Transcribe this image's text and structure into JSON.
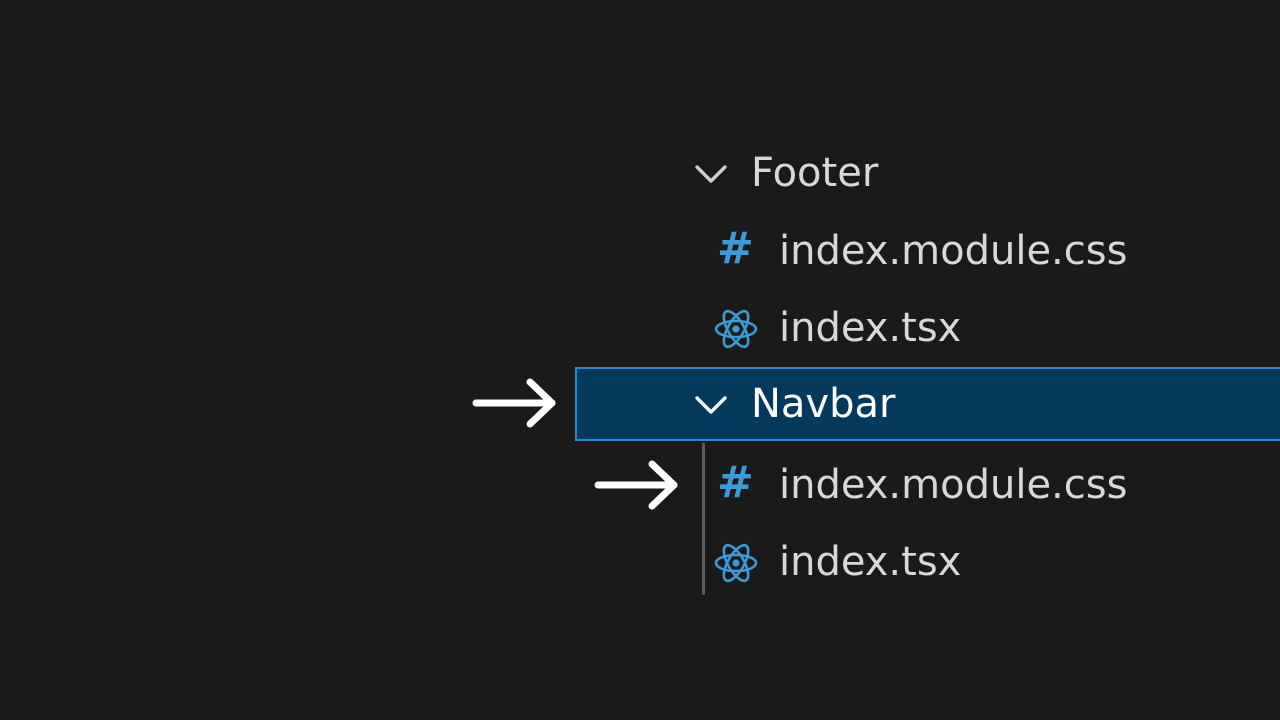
{
  "explorer": {
    "folders": [
      {
        "name": "Footer",
        "files": [
          {
            "name": "index.module.css",
            "icon": "css-hash-icon"
          },
          {
            "name": "index.tsx",
            "icon": "react-icon"
          }
        ]
      },
      {
        "name": "Navbar",
        "selected": true,
        "files": [
          {
            "name": "index.module.css",
            "icon": "css-hash-icon"
          },
          {
            "name": "index.tsx",
            "icon": "react-icon"
          }
        ]
      }
    ]
  },
  "colors": {
    "background": "#1a1a1a",
    "selection_bg": "#04395e",
    "selection_border": "#1f8ad2",
    "css_icon": "#3c9ad6",
    "react_icon": "#3c9ad6",
    "text": "#d8d8d8",
    "annotation_arrow": "#ffffff"
  },
  "annotations": {
    "arrow_icon": "right-arrow-icon"
  }
}
